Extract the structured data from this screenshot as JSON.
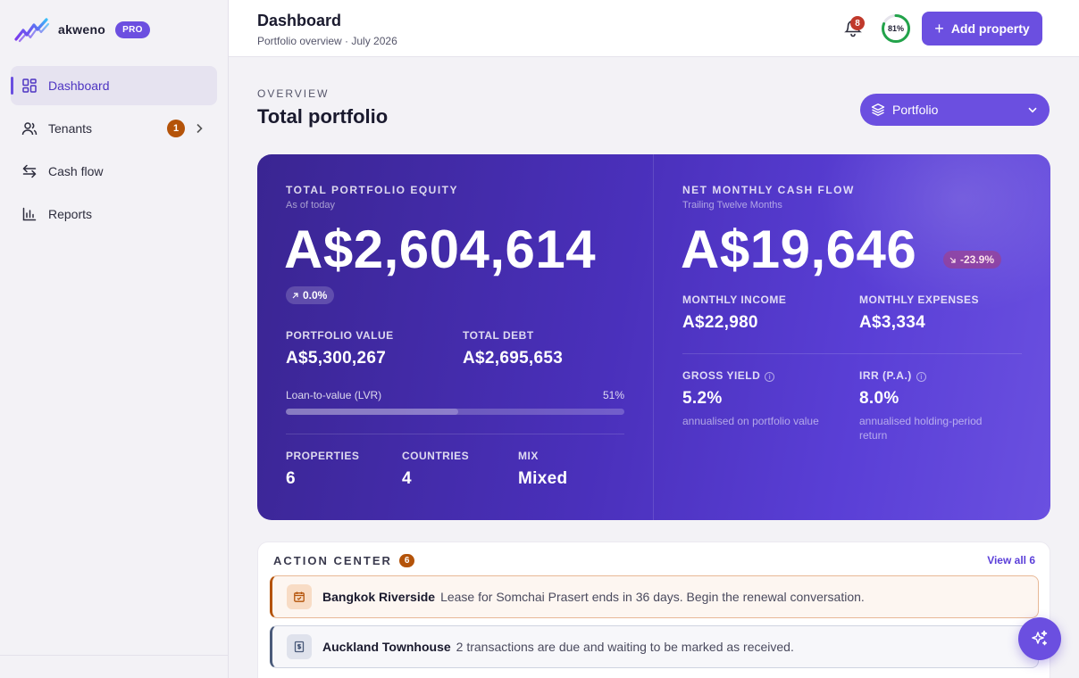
{
  "brand": {
    "name": "akweno",
    "plan_badge": "PRO"
  },
  "sidebar": {
    "items": [
      {
        "label": "Dashboard",
        "icon": "dashboard-icon",
        "active": true
      },
      {
        "label": "Tenants",
        "icon": "users-icon",
        "count": "1"
      },
      {
        "label": "Cash flow",
        "icon": "arrows-swap-icon"
      },
      {
        "label": "Reports",
        "icon": "bar-chart-icon"
      }
    ]
  },
  "header": {
    "title": "Dashboard",
    "subtitle": "Portfolio overview · July 2026",
    "notifications_count": "8",
    "score_label": "81%",
    "score_fraction": 0.81,
    "add_button_label": "Add property"
  },
  "overview": {
    "eyebrow": "OVERVIEW",
    "title": "Total portfolio",
    "scope_select_value": "Portfolio"
  },
  "equity": {
    "label": "TOTAL PORTFOLIO EQUITY",
    "sublabel": "As of today",
    "value": "A$2,604,614",
    "change": "0.0%",
    "portfolio_value_label": "PORTFOLIO VALUE",
    "portfolio_value": "A$5,300,267",
    "total_debt_label": "TOTAL DEBT",
    "total_debt": "A$2,695,653",
    "lvr_label": "Loan-to-value (LVR)",
    "lvr_pct": "51%",
    "lvr_fraction": 0.51,
    "properties_label": "PROPERTIES",
    "properties": "6",
    "countries_label": "COUNTRIES",
    "countries": "4",
    "mix_label": "MIX",
    "mix": "Mixed"
  },
  "cashflow": {
    "label": "NET MONTHLY CASH FLOW",
    "sublabel": "Trailing Twelve Months",
    "value": "A$19,646",
    "change": "-23.9%",
    "income_label": "MONTHLY INCOME",
    "income": "A$22,980",
    "expenses_label": "MONTHLY EXPENSES",
    "expenses": "A$3,334",
    "gross_yield_label": "GROSS YIELD",
    "gross_yield": "5.2%",
    "gross_yield_note": "annualised on portfolio value",
    "irr_label": "IRR (P.A.)",
    "irr": "8.0%",
    "irr_note": "annualised holding-period return"
  },
  "action_center": {
    "title": "ACTION CENTER",
    "count": "6",
    "view_all": "View all 6",
    "rows": [
      {
        "property": "Bangkok Riverside",
        "message": "Lease for Somchai Prasert ends in 36 days. Begin the renewal conversation.",
        "icon": "calendar-icon",
        "severity": "warning"
      },
      {
        "property": "Auckland Townhouse",
        "message": "2 transactions are due and waiting to be marked as received.",
        "icon": "receipt-icon",
        "severity": "info"
      }
    ]
  },
  "colors": {
    "accent": "#6b4fe0",
    "warning": "#b45309",
    "danger": "#c0392b"
  }
}
